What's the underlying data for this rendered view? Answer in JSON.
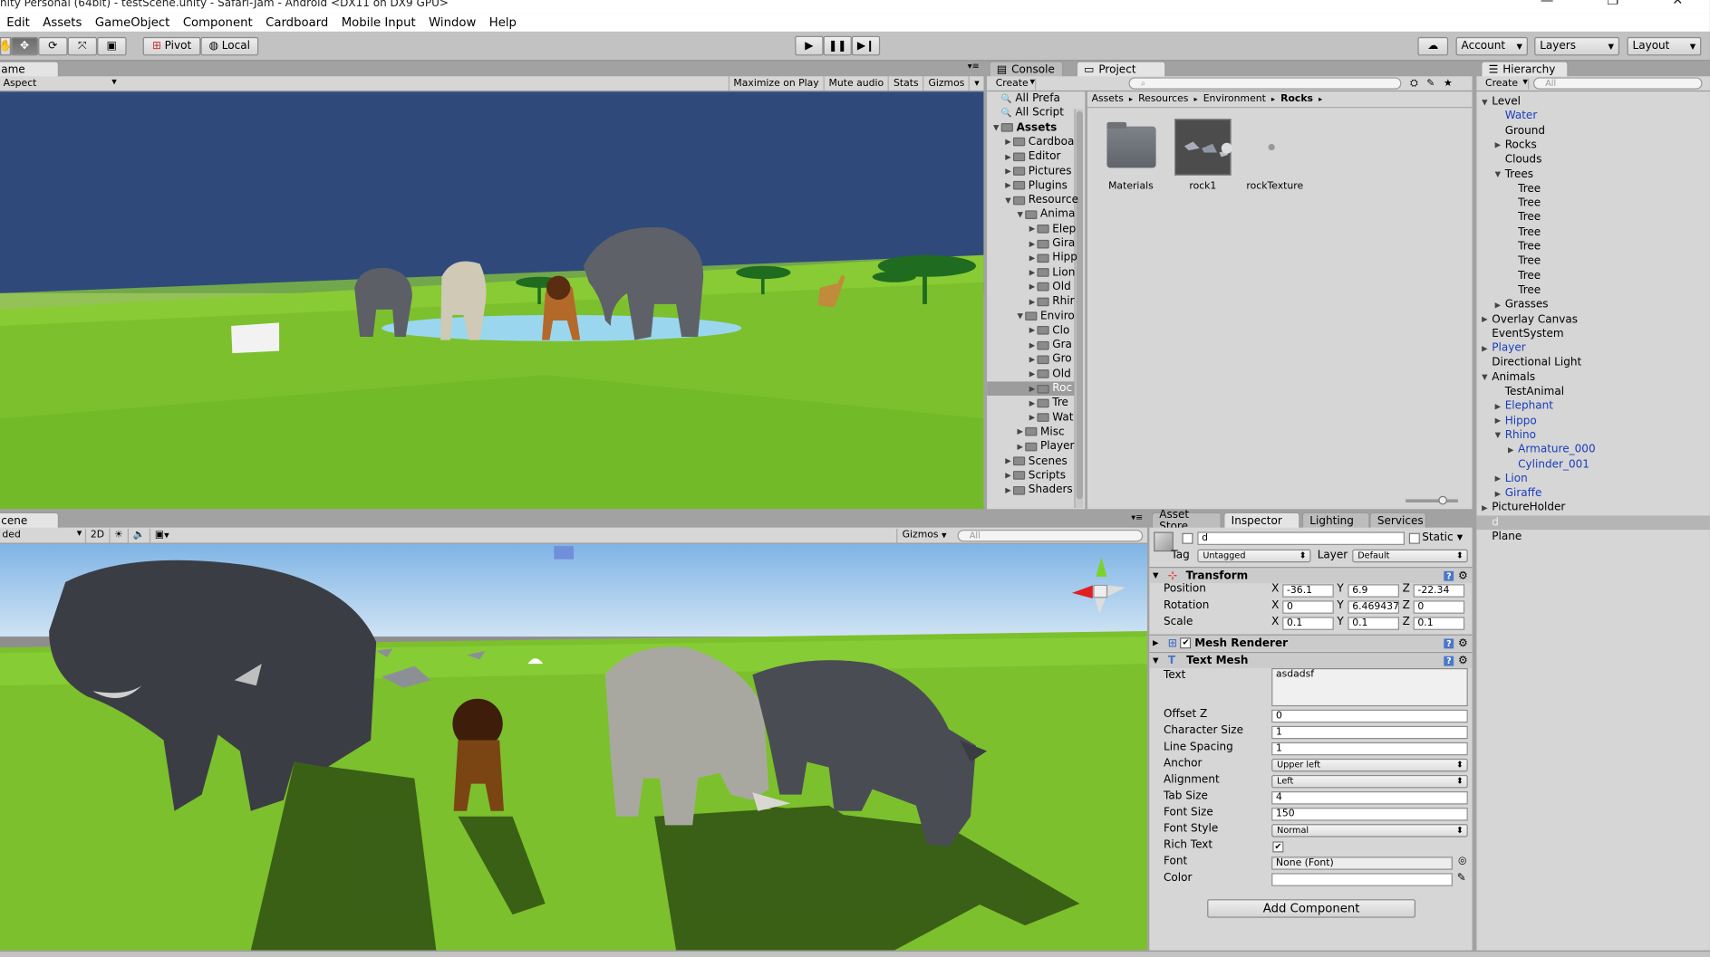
{
  "window": {
    "title": "nity Personal (64bit) - testScene.unity - Safari-Jam - Android <DX11 on DX9 GPU>",
    "minimize": "—",
    "restore": "❐",
    "close": "✕"
  },
  "menu": [
    "Edit",
    "Assets",
    "GameObject",
    "Component",
    "Cardboard",
    "Mobile Input",
    "Window",
    "Help"
  ],
  "toolbar": {
    "pivot": "Pivot",
    "local": "Local",
    "account": "Account",
    "layers": "Layers",
    "layout": "Layout"
  },
  "game": {
    "tab": "ame",
    "aspect": "Aspect",
    "buttons": [
      "Maximize on Play",
      "Mute audio",
      "Stats",
      "Gizmos"
    ]
  },
  "scene": {
    "tab": "cene",
    "shading": "ded",
    "mode2d": "2D",
    "gizmos": "Gizmos",
    "search_placeholder": "All"
  },
  "project": {
    "tabs": [
      "Console",
      "Project"
    ],
    "create": "Create",
    "breadcrumb": [
      "Assets",
      "Resources",
      "Environment",
      "Rocks"
    ],
    "tree": [
      {
        "label": "All Prefa",
        "depth": 0,
        "kind": "search"
      },
      {
        "label": "All Script",
        "depth": 0,
        "kind": "search"
      },
      {
        "label": "Assets",
        "depth": 0,
        "kind": "folder",
        "open": true,
        "bold": true
      },
      {
        "label": "Cardboa",
        "depth": 1,
        "kind": "folder"
      },
      {
        "label": "Editor",
        "depth": 1,
        "kind": "folder"
      },
      {
        "label": "Pictures",
        "depth": 1,
        "kind": "folder"
      },
      {
        "label": "Plugins",
        "depth": 1,
        "kind": "folder"
      },
      {
        "label": "Resource",
        "depth": 1,
        "kind": "folder",
        "open": true
      },
      {
        "label": "Anima",
        "depth": 2,
        "kind": "folder",
        "open": true
      },
      {
        "label": "Elep",
        "depth": 3,
        "kind": "folder"
      },
      {
        "label": "Gira",
        "depth": 3,
        "kind": "folder"
      },
      {
        "label": "Hipp",
        "depth": 3,
        "kind": "folder"
      },
      {
        "label": "Lion",
        "depth": 3,
        "kind": "folder"
      },
      {
        "label": "Old",
        "depth": 3,
        "kind": "folder"
      },
      {
        "label": "Rhir",
        "depth": 3,
        "kind": "folder"
      },
      {
        "label": "Enviro",
        "depth": 2,
        "kind": "folder",
        "open": true
      },
      {
        "label": "Clo",
        "depth": 3,
        "kind": "folder"
      },
      {
        "label": "Gra",
        "depth": 3,
        "kind": "folder"
      },
      {
        "label": "Gro",
        "depth": 3,
        "kind": "folder"
      },
      {
        "label": "Old",
        "depth": 3,
        "kind": "folder"
      },
      {
        "label": "Roc",
        "depth": 3,
        "kind": "folder",
        "selected": true
      },
      {
        "label": "Tre",
        "depth": 3,
        "kind": "folder"
      },
      {
        "label": "Wat",
        "depth": 3,
        "kind": "folder"
      },
      {
        "label": "Misc",
        "depth": 2,
        "kind": "folder"
      },
      {
        "label": "Player",
        "depth": 2,
        "kind": "folder"
      },
      {
        "label": "Scenes",
        "depth": 1,
        "kind": "folder"
      },
      {
        "label": "Scripts",
        "depth": 1,
        "kind": "folder"
      },
      {
        "label": "Shaders",
        "depth": 1,
        "kind": "folder"
      }
    ],
    "assets": [
      "Materials",
      "rock1",
      "rockTexture"
    ]
  },
  "hierarchy": {
    "tab": "Hierarchy",
    "create": "Create",
    "search_placeholder": "All",
    "items": [
      {
        "label": "Level",
        "depth": 0,
        "arrow": "open"
      },
      {
        "label": "Water",
        "depth": 1,
        "blue": true
      },
      {
        "label": "Ground",
        "depth": 1
      },
      {
        "label": "Rocks",
        "depth": 1,
        "arrow": "closed"
      },
      {
        "label": "Clouds",
        "depth": 1
      },
      {
        "label": "Trees",
        "depth": 1,
        "arrow": "open"
      },
      {
        "label": "Tree",
        "depth": 2
      },
      {
        "label": "Tree",
        "depth": 2
      },
      {
        "label": "Tree",
        "depth": 2
      },
      {
        "label": "Tree",
        "depth": 2
      },
      {
        "label": "Tree",
        "depth": 2
      },
      {
        "label": "Tree",
        "depth": 2
      },
      {
        "label": "Tree",
        "depth": 2
      },
      {
        "label": "Tree",
        "depth": 2
      },
      {
        "label": "Grasses",
        "depth": 1,
        "arrow": "closed"
      },
      {
        "label": "Overlay Canvas",
        "depth": 0,
        "arrow": "closed"
      },
      {
        "label": "EventSystem",
        "depth": 0
      },
      {
        "label": "Player",
        "depth": 0,
        "arrow": "closed",
        "blue": true
      },
      {
        "label": "Directional Light",
        "depth": 0
      },
      {
        "label": "Animals",
        "depth": 0,
        "arrow": "open"
      },
      {
        "label": "TestAnimal",
        "depth": 1
      },
      {
        "label": "Elephant",
        "depth": 1,
        "arrow": "closed",
        "blue": true
      },
      {
        "label": "Hippo",
        "depth": 1,
        "arrow": "closed",
        "blue": true
      },
      {
        "label": "Rhino",
        "depth": 1,
        "arrow": "open",
        "blue": true
      },
      {
        "label": "Armature_000",
        "depth": 2,
        "arrow": "closed",
        "blue": true
      },
      {
        "label": "Cylinder_001",
        "depth": 2,
        "blue": true
      },
      {
        "label": "Lion",
        "depth": 1,
        "arrow": "closed",
        "blue": true
      },
      {
        "label": "Giraffe",
        "depth": 1,
        "arrow": "closed",
        "blue": true
      },
      {
        "label": "PictureHolder",
        "depth": 0,
        "arrow": "closed"
      },
      {
        "label": "d",
        "depth": 0,
        "selected": true
      },
      {
        "label": "Plane",
        "depth": 0
      }
    ]
  },
  "inspector": {
    "tabs": [
      "Asset Store",
      "Inspector",
      "Lighting",
      "Services"
    ],
    "object_name": "d",
    "static_label": "Static",
    "tag_label": "Tag",
    "tag_value": "Untagged",
    "layer_label": "Layer",
    "layer_value": "Default",
    "transform": {
      "title": "Transform",
      "rows": [
        {
          "label": "Position",
          "x": "-36.1",
          "y": "6.9",
          "z": "-22.34"
        },
        {
          "label": "Rotation",
          "x": "0",
          "y": "6.469437",
          "z": "0"
        },
        {
          "label": "Scale",
          "x": "0.1",
          "y": "0.1",
          "z": "0.1"
        }
      ]
    },
    "mesh_renderer": "Mesh Renderer",
    "text_mesh": {
      "title": "Text Mesh",
      "text_label": "Text",
      "text_value": "asdadsf",
      "rows": [
        {
          "label": "Offset Z",
          "value": "0",
          "kind": "field"
        },
        {
          "label": "Character Size",
          "value": "1",
          "kind": "field"
        },
        {
          "label": "Line Spacing",
          "value": "1",
          "kind": "field"
        },
        {
          "label": "Anchor",
          "value": "Upper left",
          "kind": "dropdown"
        },
        {
          "label": "Alignment",
          "value": "Left",
          "kind": "dropdown"
        },
        {
          "label": "Tab Size",
          "value": "4",
          "kind": "field"
        },
        {
          "label": "Font Size",
          "value": "150",
          "kind": "field"
        },
        {
          "label": "Font Style",
          "value": "Normal",
          "kind": "dropdown"
        },
        {
          "label": "Rich Text",
          "value": "",
          "kind": "check"
        },
        {
          "label": "Font",
          "value": "None (Font)",
          "kind": "object"
        },
        {
          "label": "Color",
          "value": "",
          "kind": "color"
        }
      ]
    },
    "add_component": "Add Component"
  }
}
